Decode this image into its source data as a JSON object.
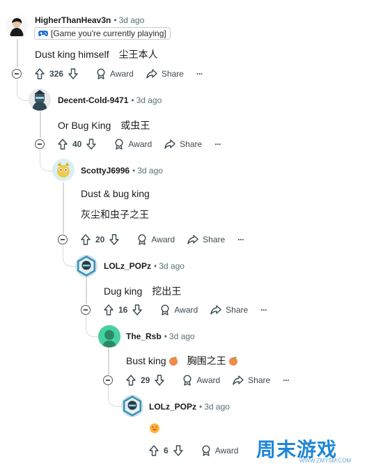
{
  "comments": [
    {
      "author": "HigherThanHeav3n",
      "time": "3d ago",
      "flair": "[Game you're currently playing]",
      "body": [
        "Dust king himself　尘王本人"
      ],
      "score": "326"
    },
    {
      "author": "Decent-Cold-9471",
      "time": "3d ago",
      "body": [
        "Or Bug King　或虫王"
      ],
      "score": "40"
    },
    {
      "author": "ScottyJ6996",
      "time": "3d ago",
      "body": [
        "Dust & bug king",
        "灰尘和虫子之王"
      ],
      "score": "20"
    },
    {
      "author": "LOLz_POPz",
      "time": "3d ago",
      "body": [
        "Dug king　挖出王"
      ],
      "score": "16"
    },
    {
      "author": "The_Rsb",
      "time": "3d ago",
      "body": [
        "Bust king",
        "胸围之王"
      ],
      "score": "29"
    },
    {
      "author": "LOLz_POPz",
      "time": "3d ago",
      "body": [],
      "score": "6"
    }
  ],
  "actions": {
    "award": "Award",
    "share": "Share",
    "more": "···"
  },
  "watermark": {
    "text": "周末游戏",
    "url": "WWW.ZMYSM.COM"
  },
  "colors": {
    "meta": "#576f76",
    "thread_line": "#d7dadc",
    "watermark": "#1f86d6"
  }
}
